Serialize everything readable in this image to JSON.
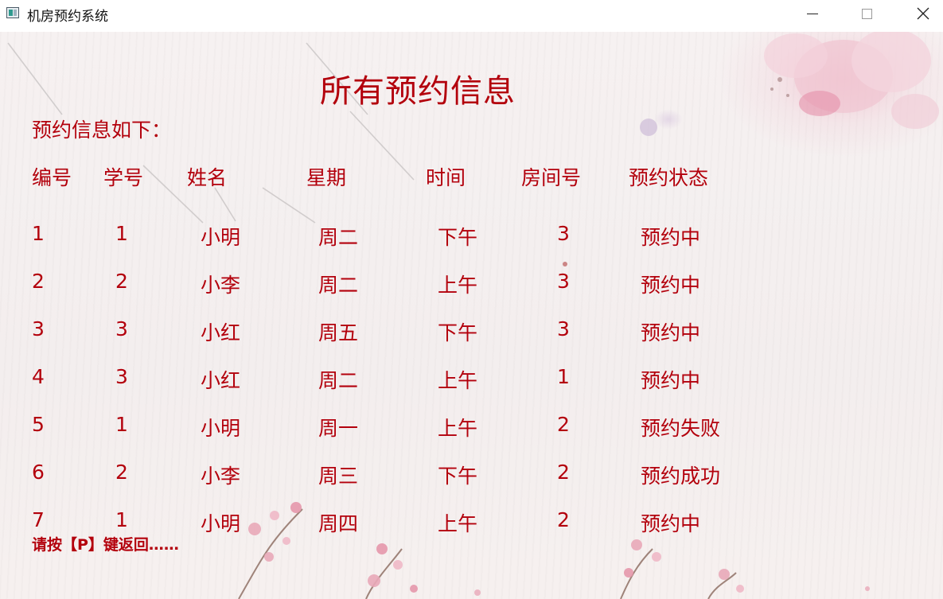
{
  "window": {
    "title": "机房预约系统",
    "controls": [
      "minimize",
      "maximize",
      "close"
    ]
  },
  "page": {
    "title": "所有预约信息",
    "subtitle": "预约信息如下：",
    "footer": "请按【P】键返回……"
  },
  "table": {
    "headers": [
      "编号",
      "学号",
      "姓名",
      "星期",
      "时间",
      "房间号",
      "预约状态"
    ],
    "rows": [
      [
        "1",
        "1",
        "小明",
        "周二",
        "下午",
        "3",
        "预约中"
      ],
      [
        "2",
        "2",
        "小李",
        "周二",
        "上午",
        "3",
        "预约中"
      ],
      [
        "3",
        "3",
        "小红",
        "周五",
        "下午",
        "3",
        "预约中"
      ],
      [
        "4",
        "3",
        "小红",
        "周二",
        "上午",
        "1",
        "预约中"
      ],
      [
        "5",
        "1",
        "小明",
        "周一",
        "上午",
        "2",
        "预约失败"
      ],
      [
        "6",
        "2",
        "小李",
        "周三",
        "下午",
        "2",
        "预约成功"
      ],
      [
        "7",
        "1",
        "小明",
        "周四",
        "上午",
        "2",
        "预约中"
      ]
    ]
  },
  "colors": {
    "text": "#b3000c",
    "background": "#f4efef",
    "blossom": "#e8a2b6"
  },
  "icons": [
    "app-icon",
    "minimize-icon",
    "maximize-icon",
    "close-icon"
  ]
}
